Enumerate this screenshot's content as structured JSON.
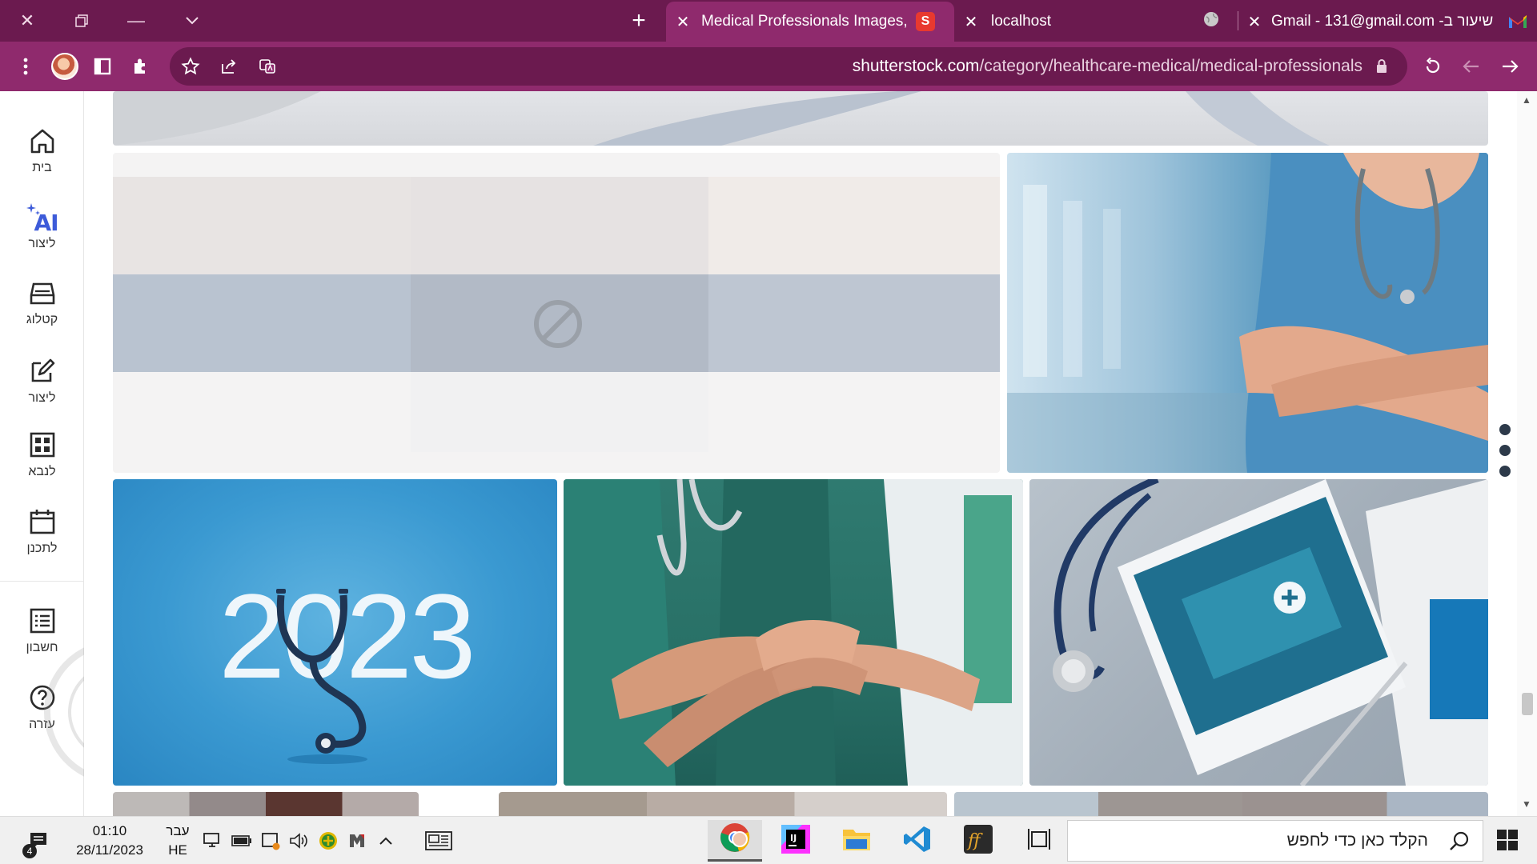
{
  "browser": {
    "tabs": [
      {
        "title": "שיעור ב- Gmail - 131@gmail.com",
        "favicon": "gmail-icon",
        "active": false
      },
      {
        "title": "localhost",
        "favicon": "globe-icon",
        "active": false
      },
      {
        "title": "Medical Professionals Images, Pi",
        "favicon": "shutterstock-icon",
        "active": true
      }
    ],
    "url_host": "shutterstock.com",
    "url_path": "/category/healthcare-medical/medical-professionals",
    "favicon_letter": "S"
  },
  "sidebar": {
    "items": [
      {
        "label": "בית",
        "icon": "home-icon"
      },
      {
        "label": "ליצור",
        "icon": "ai-sparkle-icon",
        "icon_text": "AI"
      },
      {
        "label": "קטלוג",
        "icon": "catalog-icon"
      },
      {
        "label": "ליצור",
        "icon": "edit-icon"
      },
      {
        "label": "לנבא",
        "icon": "grid-icon"
      },
      {
        "label": "לתכנן",
        "icon": "calendar-icon"
      },
      {
        "label": "חשבון",
        "icon": "list-icon"
      },
      {
        "label": "עזרה",
        "icon": "help-icon"
      }
    ]
  },
  "images": [
    {
      "name": "doctor-hands-banner"
    },
    {
      "name": "blocked-image-placeholder"
    },
    {
      "name": "nurse-stethoscope-hospital"
    },
    {
      "name": "stethoscope-2023",
      "text": "2023"
    },
    {
      "name": "nurses-hands-together"
    },
    {
      "name": "tablet-stethoscope"
    }
  ],
  "taskbar": {
    "time": "01:10",
    "date": "28/11/2023",
    "lang_top": "עבר",
    "lang_bottom": "HE",
    "notif_count": "4",
    "search_placeholder": "הקלד כאן כדי לחפש"
  },
  "colors": {
    "tab_strip": "#6b1a4f",
    "toolbar": "#8f2a6d",
    "accent_ai": "#3d5bd9"
  }
}
